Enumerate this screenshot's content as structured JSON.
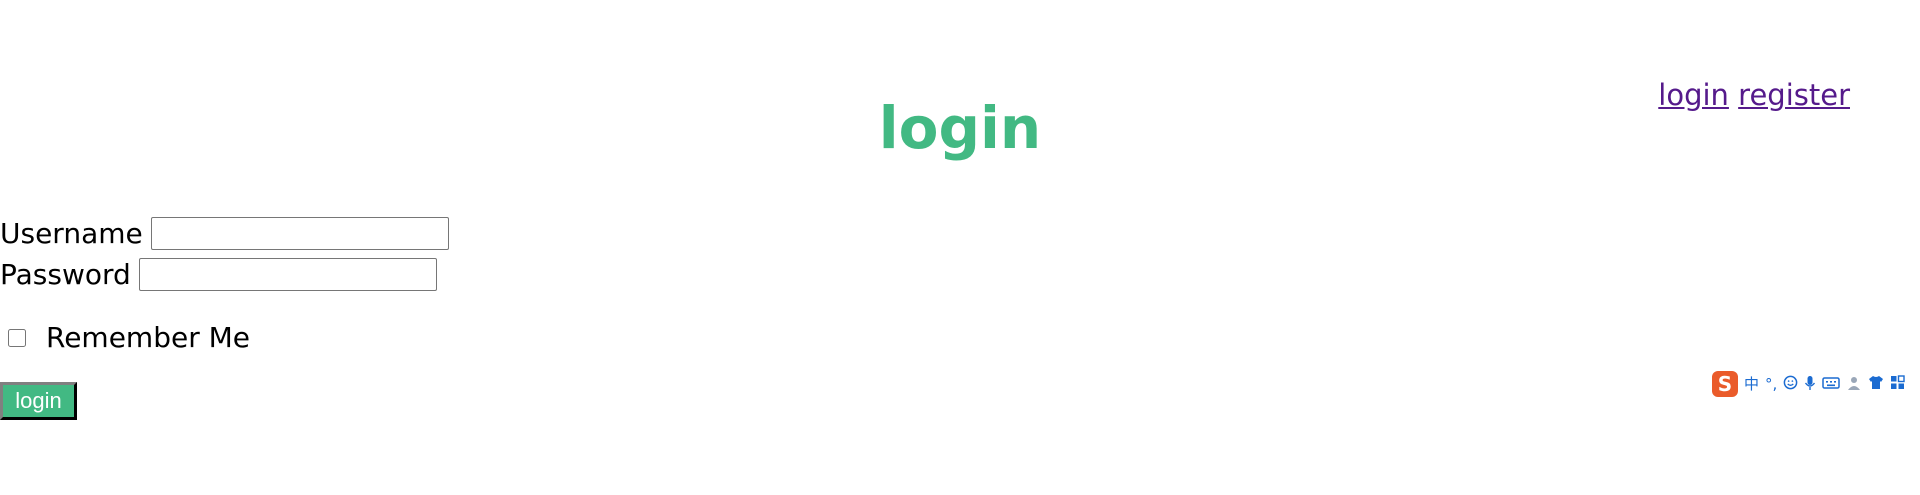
{
  "nav": {
    "login_label": "login",
    "register_label": "register"
  },
  "page": {
    "title": "login"
  },
  "form": {
    "username_label": "Username",
    "username_value": "",
    "password_label": "Password",
    "password_value": "",
    "remember_label": "Remember Me",
    "remember_checked": false,
    "submit_label": "login"
  },
  "ime_toolbar": {
    "logo_text": "S",
    "mode_text": "中",
    "punct_text": "°,",
    "icons": [
      "emoji-icon",
      "microphone-icon",
      "keyboard-icon",
      "user-icon",
      "shirt-icon",
      "grid-icon"
    ]
  },
  "colors": {
    "accent": "#42b983",
    "link_visited": "#551a8b",
    "ime_logo": "#ea5b2a"
  }
}
